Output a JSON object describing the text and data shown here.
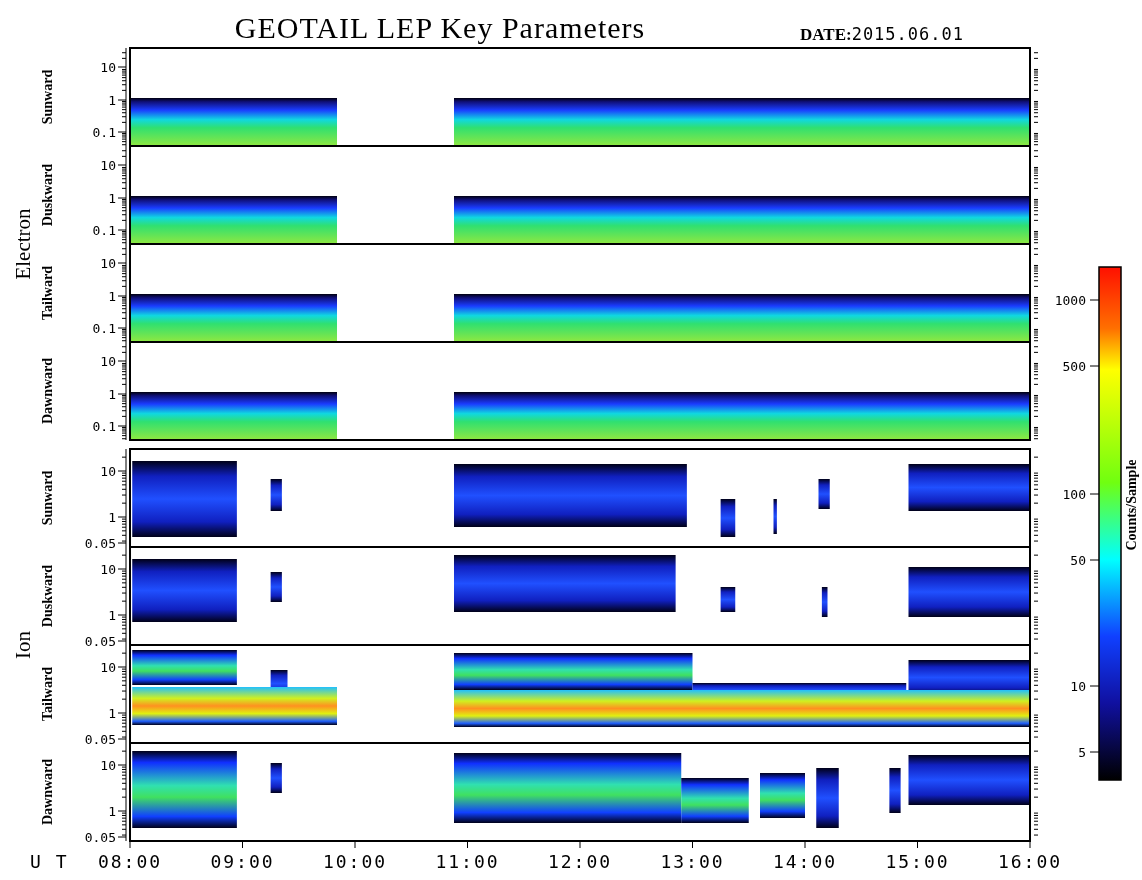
{
  "title": "GEOTAIL LEP Key Parameters",
  "date_label": "DATE:",
  "date": "2015.06.01",
  "groups": [
    {
      "label": "Electron",
      "kind": "electron",
      "panels": [
        {
          "label": "Sunward",
          "yticks": [
            "10",
            "1",
            "0.1"
          ]
        },
        {
          "label": "Duskward",
          "yticks": [
            "10",
            "1",
            "0.1"
          ]
        },
        {
          "label": "Tailward",
          "yticks": [
            "10",
            "1",
            "0.1"
          ]
        },
        {
          "label": "Dawnward",
          "yticks": [
            "10",
            "1",
            "0.1"
          ]
        }
      ]
    },
    {
      "label": "Ion",
      "kind": "ion",
      "panels": [
        {
          "label": "Sunward",
          "yticks": [
            "10",
            "1",
            "0.05"
          ]
        },
        {
          "label": "Duskward",
          "yticks": [
            "10",
            "1",
            "0.05"
          ]
        },
        {
          "label": "Tailward",
          "yticks": [
            "10",
            "1",
            "0.05"
          ]
        },
        {
          "label": "Dawnward",
          "yticks": [
            "10",
            "1",
            "0.05"
          ]
        }
      ]
    }
  ],
  "x_axis": {
    "label": "U T",
    "ticks": [
      "08:00",
      "09:00",
      "10:00",
      "11:00",
      "12:00",
      "13:00",
      "14:00",
      "15:00",
      "16:00"
    ]
  },
  "colorbar": {
    "label": "Counts/Sample",
    "ticks": [
      "1000",
      "500",
      "100",
      "50",
      "10",
      "5"
    ]
  }
}
